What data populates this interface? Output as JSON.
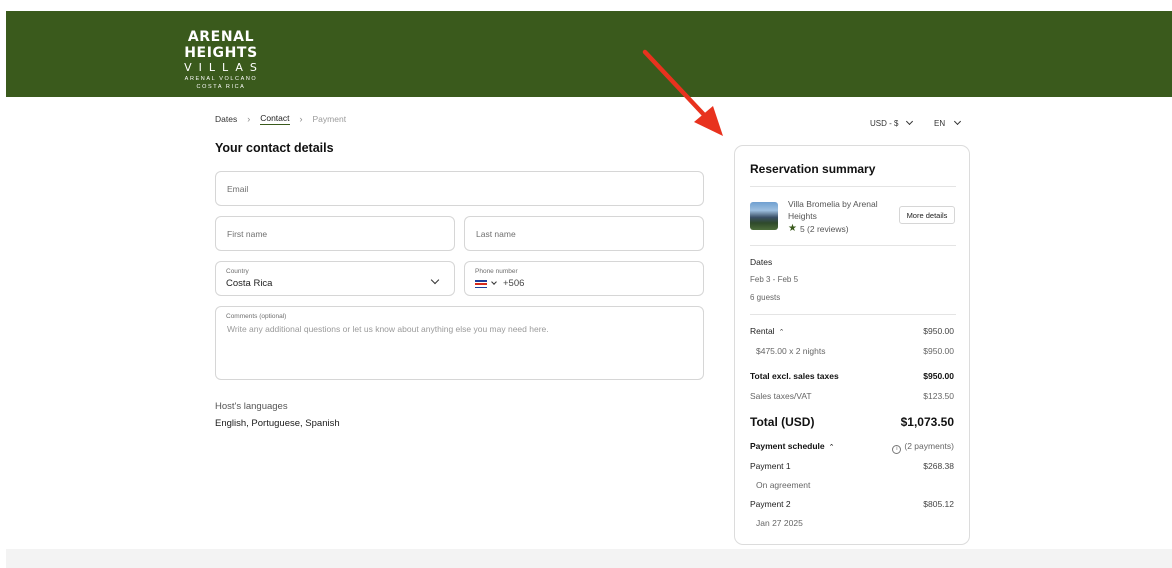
{
  "brand": {
    "line1": "ARENAL HEIGHTS",
    "line2": "VILLAS",
    "line3": "ARENAL VOLCANO",
    "line4": "COSTA RICA",
    "color": "#3a5a1c"
  },
  "breadcrumb": {
    "steps": [
      "Dates",
      "Contact",
      "Payment"
    ],
    "separator": "›",
    "active_step": "Contact"
  },
  "topbar": {
    "currency": "USD - $",
    "language": "EN"
  },
  "form": {
    "title": "Your contact details",
    "email_placeholder": "Email",
    "first_name_placeholder": "First name",
    "last_name_placeholder": "Last name",
    "country_label": "Country",
    "country_value": "Costa Rica",
    "phone_label": "Phone number",
    "phone_code": "+506",
    "phone_flag": "costa-rica-flag",
    "comments_label": "Comments (optional)",
    "comments_placeholder": "Write any additional questions or let us know about anything else you may need here."
  },
  "host_languages": {
    "label": "Host's languages",
    "value": "English, Portuguese, Spanish"
  },
  "summary": {
    "title": "Reservation summary",
    "property_name": "Villa Bromelia by Arenal Heights",
    "rating": "5 (2 reviews)",
    "more_details_label": "More details",
    "dates_label": "Dates",
    "date_range": "Feb 3 - Feb 5",
    "guests": "6 guests",
    "rental_label": "Rental",
    "rental_amount": "$950.00",
    "nightly_label": "$475.00 x 2 nights",
    "nightly_amount": "$950.00",
    "total_excl_label": "Total excl. sales taxes",
    "total_excl_amount": "$950.00",
    "taxes_label": "Sales taxes/VAT",
    "taxes_amount": "$123.50",
    "total_label": "Total (USD)",
    "total_amount": "$1,073.50",
    "schedule_label": "Payment schedule",
    "schedule_count": "(2 payments)",
    "payments": [
      {
        "label": "Payment 1",
        "amount": "$268.38",
        "when": "On agreement"
      },
      {
        "label": "Payment 2",
        "amount": "$805.12",
        "when": "Jan 27 2025"
      }
    ]
  },
  "annotation": {
    "arrow_color": "#e8321e"
  }
}
